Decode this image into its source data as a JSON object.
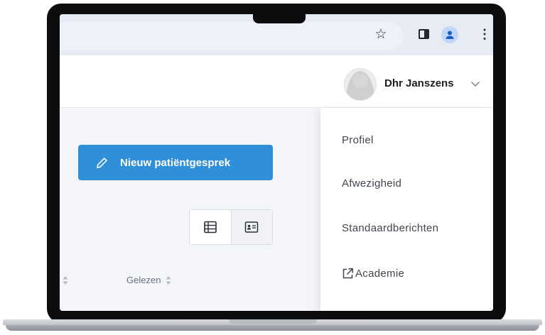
{
  "browser": {
    "icons": [
      "star-icon",
      "side-panel-icon",
      "profile-icon",
      "menu-icon"
    ],
    "star_glyph": "☆",
    "menu_glyph": "⋮"
  },
  "header": {
    "user_name": "Dhr Janszens"
  },
  "main": {
    "new_button_label": "Nieuw patiëntgesprek",
    "view_toggle": [
      "table-view-icon",
      "card-view-icon"
    ],
    "column_header": "Gelezen"
  },
  "user_menu": {
    "items": [
      {
        "label": "Profiel"
      },
      {
        "label": "Afwezigheid"
      },
      {
        "label": "Standaardberichten"
      },
      {
        "label": "Academie",
        "icon": "external-link-icon"
      }
    ]
  },
  "colors": {
    "accent": "#2f8fd8",
    "bezel": "#0d0d0f",
    "chrome_bar": "#e7ebf3",
    "page_bg": "#f3f5f8"
  }
}
